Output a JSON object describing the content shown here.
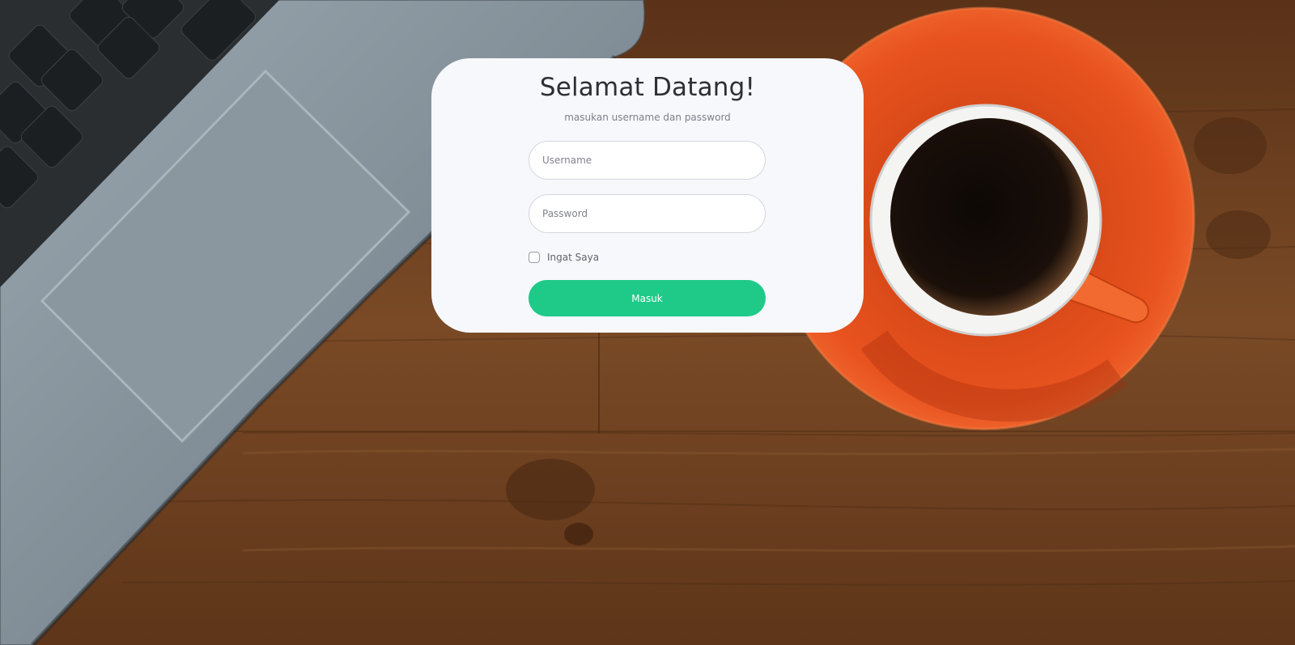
{
  "login": {
    "title": "Selamat Datang!",
    "subtitle": "masukan username dan password",
    "username_placeholder": "Username",
    "username_value": "",
    "password_placeholder": "Password",
    "password_value": "",
    "remember_label": "Ingat Saya",
    "remember_checked": false,
    "submit_label": "Masuk"
  },
  "background": {
    "description_icons": [
      "laptop",
      "coffee-cup",
      "saucer",
      "wooden-table"
    ]
  },
  "colors": {
    "accent": "#1fca89",
    "card_background": "#f7f8fc",
    "title_text": "#2f2f33",
    "saucer": "#e8521f"
  }
}
